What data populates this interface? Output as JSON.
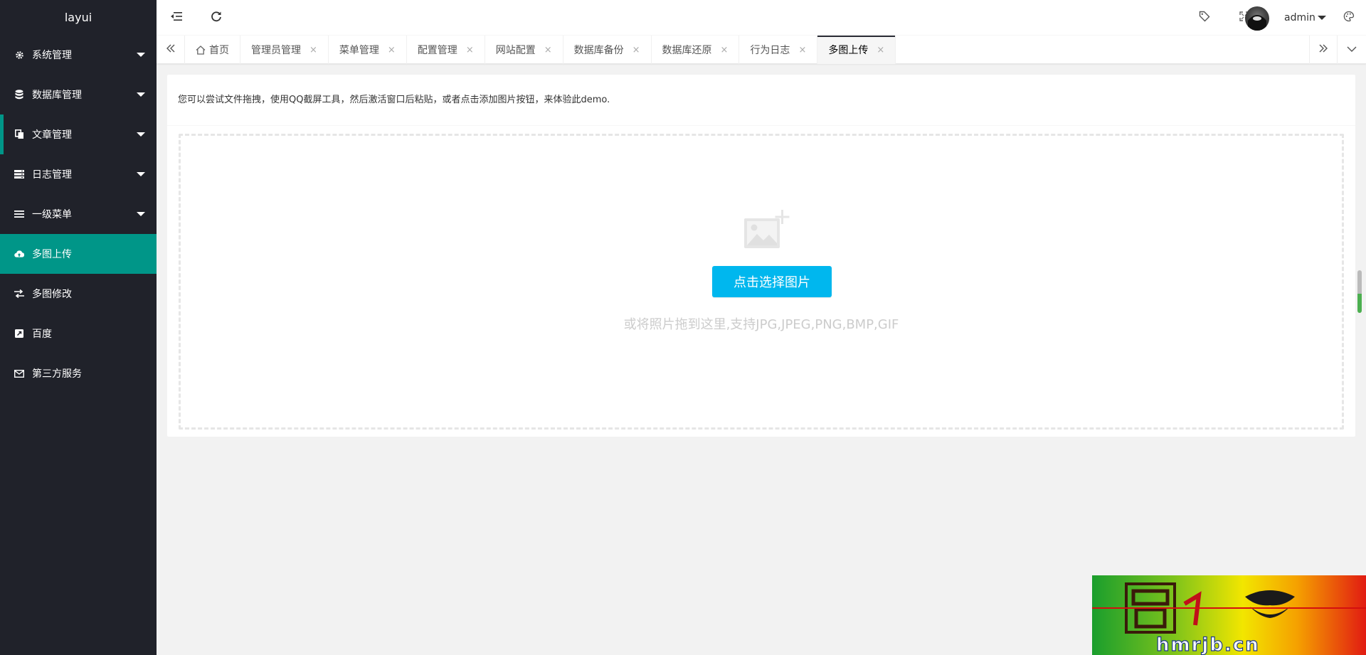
{
  "sidebar": {
    "logo": "layui",
    "items": [
      {
        "label": "系统管理",
        "icon": "gear-icon"
      },
      {
        "label": "数据库管理",
        "icon": "database-icon"
      },
      {
        "label": "文章管理",
        "icon": "copy-icon"
      },
      {
        "label": "日志管理",
        "icon": "server-icon"
      },
      {
        "label": "一级菜单",
        "icon": "bars-icon"
      },
      {
        "label": "多图上传",
        "icon": "cloud-upload-icon"
      },
      {
        "label": "多图修改",
        "icon": "exchange-icon"
      },
      {
        "label": "百度",
        "icon": "external-link-icon"
      },
      {
        "label": "第三方服务",
        "icon": "envelope-icon"
      }
    ],
    "active_index": 5
  },
  "header": {
    "username": "admin",
    "icons": [
      "menu-fold-icon",
      "refresh-icon",
      "tag-icon",
      "fullscreen-icon",
      "theme-icon"
    ]
  },
  "tabs": {
    "items": [
      {
        "label": "首页",
        "closable": false,
        "icon": "home-icon"
      },
      {
        "label": "管理员管理",
        "closable": true
      },
      {
        "label": "菜单管理",
        "closable": true
      },
      {
        "label": "配置管理",
        "closable": true
      },
      {
        "label": "网站配置",
        "closable": true
      },
      {
        "label": "数据库备份",
        "closable": true
      },
      {
        "label": "数据库还原",
        "closable": true
      },
      {
        "label": "行为日志",
        "closable": true
      },
      {
        "label": "多图上传",
        "closable": true
      }
    ],
    "active_index": 8,
    "close_glyph": "×"
  },
  "upload": {
    "notice": "您可以尝试文件拖拽，使用QQ截屏工具，然后激活窗口后粘贴，或者点击添加图片按钮，来体验此demo.",
    "button_label": "点击选择图片",
    "hint": "或将照片拖到这里,支持JPG,JPEG,PNG,BMP,GIF"
  },
  "watermark": {
    "text": "hmrjb.cn"
  },
  "colors": {
    "sidebar_bg": "#20222a",
    "active": "#009688",
    "button": "#00b7ee"
  }
}
